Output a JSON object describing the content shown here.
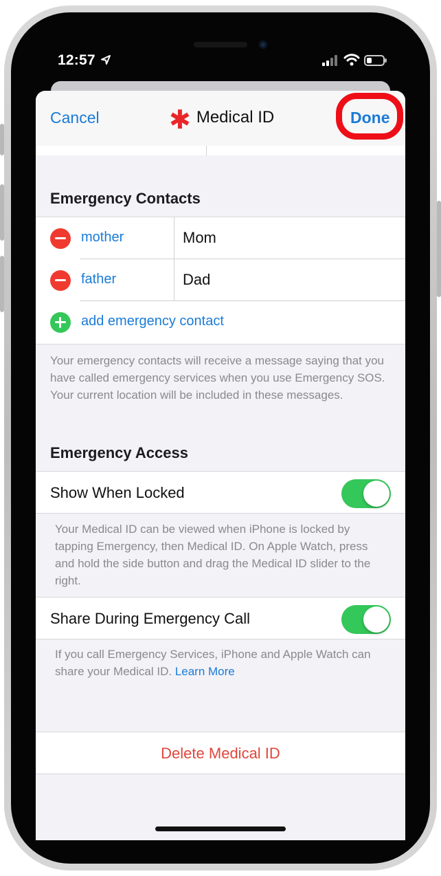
{
  "status_bar": {
    "time": "12:57"
  },
  "nav": {
    "cancel_label": "Cancel",
    "title": "Medical ID",
    "title_icon": "✱",
    "done_label": "Done"
  },
  "emergency_contacts": {
    "header": "Emergency Contacts",
    "contacts": [
      {
        "relationship": "mother",
        "name": "Mom"
      },
      {
        "relationship": "father",
        "name": "Dad"
      }
    ],
    "add_label": "add emergency contact",
    "footnote": "Your emergency contacts will receive a message saying that you have called emergency services when you use Emergency SOS. Your current location will be included in these messages."
  },
  "emergency_access": {
    "header": "Emergency Access",
    "show_when_locked": {
      "label": "Show When Locked",
      "on": true,
      "footnote": "Your Medical ID can be viewed when iPhone is locked by tapping Emergency, then Medical ID. On Apple Watch, press and hold the side button and drag the Medical ID slider to the right."
    },
    "share_during_call": {
      "label": "Share During Emergency Call",
      "on": true,
      "footnote": "If you call Emergency Services, iPhone and Apple Watch can share your Medical ID.",
      "link": "Learn More"
    }
  },
  "delete_label": "Delete Medical ID",
  "colors": {
    "accent_blue": "#1a7bd6",
    "destructive_red": "#e0473c",
    "toggle_green": "#34c759",
    "highlight_red": "#ee0e17"
  }
}
